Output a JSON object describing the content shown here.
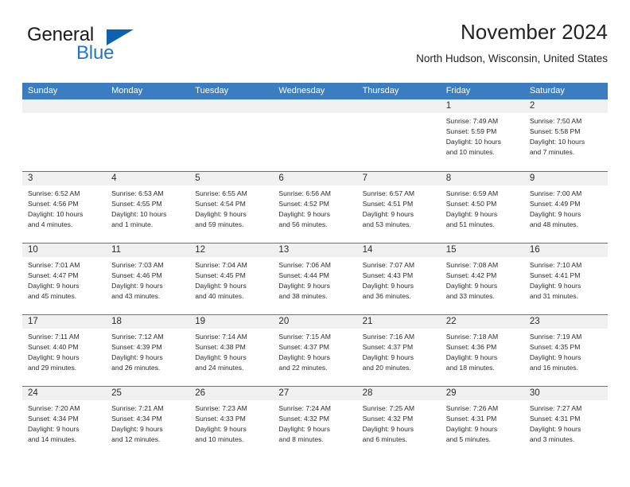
{
  "brand": {
    "word_general": "General",
    "word_blue": "Blue",
    "triangle_color": "#0c62b0",
    "blue_color": "#2278c0"
  },
  "header": {
    "title": "November 2024",
    "subtitle": "North Hudson, Wisconsin, United States",
    "accent_color": "#3b7dc0",
    "daynum_bg": "#f0f0f0"
  },
  "weekday_headers": [
    "Sunday",
    "Monday",
    "Tuesday",
    "Wednesday",
    "Thursday",
    "Friday",
    "Saturday"
  ],
  "labels": {
    "sunrise_prefix": "Sunrise:",
    "sunset_prefix": "Sunset:",
    "daylight_prefix": "Daylight:"
  },
  "weeks": [
    [
      {
        "day": "",
        "empty": true
      },
      {
        "day": "",
        "empty": true
      },
      {
        "day": "",
        "empty": true
      },
      {
        "day": "",
        "empty": true
      },
      {
        "day": "",
        "empty": true
      },
      {
        "day": "1",
        "sunrise": "Sunrise: 7:49 AM",
        "sunset": "Sunset: 5:59 PM",
        "daylight_l1": "Daylight: 10 hours",
        "daylight_l2": "and 10 minutes."
      },
      {
        "day": "2",
        "sunrise": "Sunrise: 7:50 AM",
        "sunset": "Sunset: 5:58 PM",
        "daylight_l1": "Daylight: 10 hours",
        "daylight_l2": "and 7 minutes."
      }
    ],
    [
      {
        "day": "3",
        "sunrise": "Sunrise: 6:52 AM",
        "sunset": "Sunset: 4:56 PM",
        "daylight_l1": "Daylight: 10 hours",
        "daylight_l2": "and 4 minutes."
      },
      {
        "day": "4",
        "sunrise": "Sunrise: 6:53 AM",
        "sunset": "Sunset: 4:55 PM",
        "daylight_l1": "Daylight: 10 hours",
        "daylight_l2": "and 1 minute."
      },
      {
        "day": "5",
        "sunrise": "Sunrise: 6:55 AM",
        "sunset": "Sunset: 4:54 PM",
        "daylight_l1": "Daylight: 9 hours",
        "daylight_l2": "and 59 minutes."
      },
      {
        "day": "6",
        "sunrise": "Sunrise: 6:56 AM",
        "sunset": "Sunset: 4:52 PM",
        "daylight_l1": "Daylight: 9 hours",
        "daylight_l2": "and 56 minutes."
      },
      {
        "day": "7",
        "sunrise": "Sunrise: 6:57 AM",
        "sunset": "Sunset: 4:51 PM",
        "daylight_l1": "Daylight: 9 hours",
        "daylight_l2": "and 53 minutes."
      },
      {
        "day": "8",
        "sunrise": "Sunrise: 6:59 AM",
        "sunset": "Sunset: 4:50 PM",
        "daylight_l1": "Daylight: 9 hours",
        "daylight_l2": "and 51 minutes."
      },
      {
        "day": "9",
        "sunrise": "Sunrise: 7:00 AM",
        "sunset": "Sunset: 4:49 PM",
        "daylight_l1": "Daylight: 9 hours",
        "daylight_l2": "and 48 minutes."
      }
    ],
    [
      {
        "day": "10",
        "sunrise": "Sunrise: 7:01 AM",
        "sunset": "Sunset: 4:47 PM",
        "daylight_l1": "Daylight: 9 hours",
        "daylight_l2": "and 45 minutes."
      },
      {
        "day": "11",
        "sunrise": "Sunrise: 7:03 AM",
        "sunset": "Sunset: 4:46 PM",
        "daylight_l1": "Daylight: 9 hours",
        "daylight_l2": "and 43 minutes."
      },
      {
        "day": "12",
        "sunrise": "Sunrise: 7:04 AM",
        "sunset": "Sunset: 4:45 PM",
        "daylight_l1": "Daylight: 9 hours",
        "daylight_l2": "and 40 minutes."
      },
      {
        "day": "13",
        "sunrise": "Sunrise: 7:06 AM",
        "sunset": "Sunset: 4:44 PM",
        "daylight_l1": "Daylight: 9 hours",
        "daylight_l2": "and 38 minutes."
      },
      {
        "day": "14",
        "sunrise": "Sunrise: 7:07 AM",
        "sunset": "Sunset: 4:43 PM",
        "daylight_l1": "Daylight: 9 hours",
        "daylight_l2": "and 36 minutes."
      },
      {
        "day": "15",
        "sunrise": "Sunrise: 7:08 AM",
        "sunset": "Sunset: 4:42 PM",
        "daylight_l1": "Daylight: 9 hours",
        "daylight_l2": "and 33 minutes."
      },
      {
        "day": "16",
        "sunrise": "Sunrise: 7:10 AM",
        "sunset": "Sunset: 4:41 PM",
        "daylight_l1": "Daylight: 9 hours",
        "daylight_l2": "and 31 minutes."
      }
    ],
    [
      {
        "day": "17",
        "sunrise": "Sunrise: 7:11 AM",
        "sunset": "Sunset: 4:40 PM",
        "daylight_l1": "Daylight: 9 hours",
        "daylight_l2": "and 29 minutes."
      },
      {
        "day": "18",
        "sunrise": "Sunrise: 7:12 AM",
        "sunset": "Sunset: 4:39 PM",
        "daylight_l1": "Daylight: 9 hours",
        "daylight_l2": "and 26 minutes."
      },
      {
        "day": "19",
        "sunrise": "Sunrise: 7:14 AM",
        "sunset": "Sunset: 4:38 PM",
        "daylight_l1": "Daylight: 9 hours",
        "daylight_l2": "and 24 minutes."
      },
      {
        "day": "20",
        "sunrise": "Sunrise: 7:15 AM",
        "sunset": "Sunset: 4:37 PM",
        "daylight_l1": "Daylight: 9 hours",
        "daylight_l2": "and 22 minutes."
      },
      {
        "day": "21",
        "sunrise": "Sunrise: 7:16 AM",
        "sunset": "Sunset: 4:37 PM",
        "daylight_l1": "Daylight: 9 hours",
        "daylight_l2": "and 20 minutes."
      },
      {
        "day": "22",
        "sunrise": "Sunrise: 7:18 AM",
        "sunset": "Sunset: 4:36 PM",
        "daylight_l1": "Daylight: 9 hours",
        "daylight_l2": "and 18 minutes."
      },
      {
        "day": "23",
        "sunrise": "Sunrise: 7:19 AM",
        "sunset": "Sunset: 4:35 PM",
        "daylight_l1": "Daylight: 9 hours",
        "daylight_l2": "and 16 minutes."
      }
    ],
    [
      {
        "day": "24",
        "sunrise": "Sunrise: 7:20 AM",
        "sunset": "Sunset: 4:34 PM",
        "daylight_l1": "Daylight: 9 hours",
        "daylight_l2": "and 14 minutes."
      },
      {
        "day": "25",
        "sunrise": "Sunrise: 7:21 AM",
        "sunset": "Sunset: 4:34 PM",
        "daylight_l1": "Daylight: 9 hours",
        "daylight_l2": "and 12 minutes."
      },
      {
        "day": "26",
        "sunrise": "Sunrise: 7:23 AM",
        "sunset": "Sunset: 4:33 PM",
        "daylight_l1": "Daylight: 9 hours",
        "daylight_l2": "and 10 minutes."
      },
      {
        "day": "27",
        "sunrise": "Sunrise: 7:24 AM",
        "sunset": "Sunset: 4:32 PM",
        "daylight_l1": "Daylight: 9 hours",
        "daylight_l2": "and 8 minutes."
      },
      {
        "day": "28",
        "sunrise": "Sunrise: 7:25 AM",
        "sunset": "Sunset: 4:32 PM",
        "daylight_l1": "Daylight: 9 hours",
        "daylight_l2": "and 6 minutes."
      },
      {
        "day": "29",
        "sunrise": "Sunrise: 7:26 AM",
        "sunset": "Sunset: 4:31 PM",
        "daylight_l1": "Daylight: 9 hours",
        "daylight_l2": "and 5 minutes."
      },
      {
        "day": "30",
        "sunrise": "Sunrise: 7:27 AM",
        "sunset": "Sunset: 4:31 PM",
        "daylight_l1": "Daylight: 9 hours",
        "daylight_l2": "and 3 minutes."
      }
    ]
  ]
}
